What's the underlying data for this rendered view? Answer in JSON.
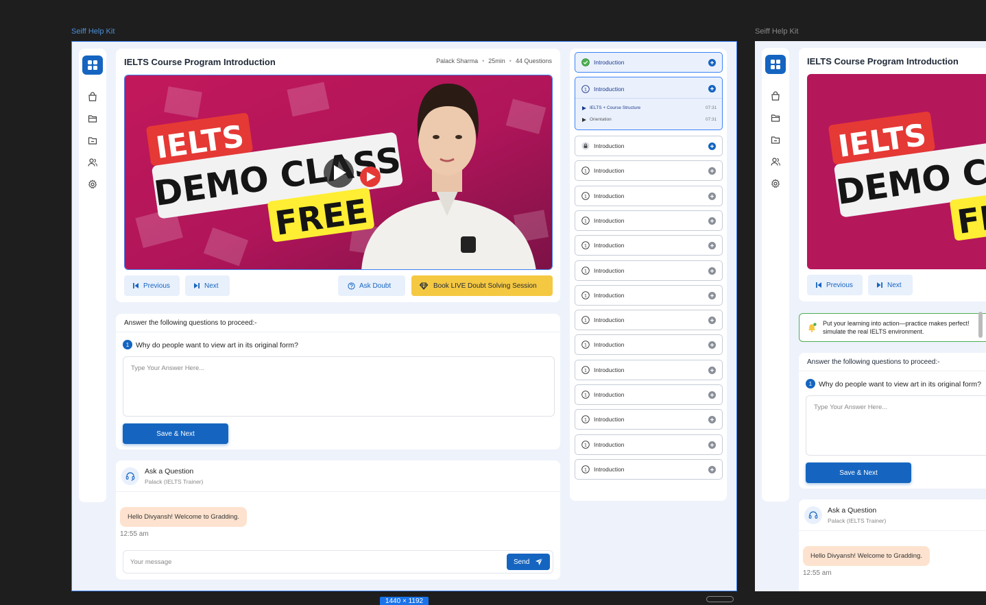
{
  "frames": {
    "primary_label": "Seiff Help Kit",
    "secondary_label": "Seiff Help Kit",
    "size_badge": "1440 × 1192"
  },
  "sidebar": {
    "items": [
      {
        "icon": "grid-icon"
      },
      {
        "icon": "bag-icon"
      },
      {
        "icon": "folder-icon"
      },
      {
        "icon": "folder-minus-icon"
      },
      {
        "icon": "users-icon"
      },
      {
        "icon": "gear-icon"
      }
    ]
  },
  "course": {
    "title": "IELTS Course Program Introduction",
    "instructor": "Palack Sharma",
    "duration": "25min",
    "questions": "44 Questions"
  },
  "video": {
    "thumbnail_line1": "IELTS",
    "thumbnail_line2": "DEMO CLASS",
    "thumbnail_line3": "FREE"
  },
  "controls": {
    "previous_label": "Previous",
    "next_label": "Next",
    "ask_doubt_label": "Ask Doubt",
    "book_session_label": "Book LIVE Doubt Solving Session"
  },
  "quiz": {
    "prompt": "Answer the following questions to proceed:-",
    "question_number": "1",
    "question_text": "Why do people want to view art in its original form?",
    "answer_placeholder": "Type Your Answer Here...",
    "save_label": "Save & Next"
  },
  "chat": {
    "title": "Ask a Question",
    "subtitle": "Palack (IELTS Trainer)",
    "message": "Hello Divyansh! Welcome to Gradding.",
    "time": "12:55 am",
    "input_placeholder": "Your message",
    "send_label": "Send"
  },
  "lessons": {
    "first": {
      "label": "Introduction",
      "status": "completed"
    },
    "expanded": {
      "label": "Introduction",
      "subitems": [
        {
          "label": "IELTS + Course Structure",
          "duration": "07:31"
        },
        {
          "label": "Orientation",
          "duration": "07:31"
        }
      ]
    },
    "items": [
      {
        "label": "Introduction",
        "icon": "lock-icon"
      },
      {
        "label": "Introduction",
        "icon": "timer-icon"
      },
      {
        "label": "Introduction",
        "icon": "timer-icon"
      },
      {
        "label": "Introduction",
        "icon": "timer-icon"
      },
      {
        "label": "Introduction",
        "icon": "timer-icon"
      },
      {
        "label": "Introduction",
        "icon": "timer-icon"
      },
      {
        "label": "Introduction",
        "icon": "timer-icon"
      },
      {
        "label": "Introduction",
        "icon": "timer-icon"
      },
      {
        "label": "Introduction",
        "icon": "timer-icon"
      },
      {
        "label": "Introduction",
        "icon": "timer-icon"
      },
      {
        "label": "Introduction",
        "icon": "timer-icon"
      },
      {
        "label": "Introduction",
        "icon": "timer-icon"
      },
      {
        "label": "Introduction",
        "icon": "timer-icon"
      },
      {
        "label": "Introduction",
        "icon": "timer-icon"
      }
    ]
  },
  "banner": {
    "line1": "Put your learning into action—practice makes perfect!",
    "line2": "simulate the real IELTS environment."
  },
  "colors": {
    "primary": "#1565c0",
    "accent_gold": "#f5c842",
    "success": "#4caf50"
  }
}
